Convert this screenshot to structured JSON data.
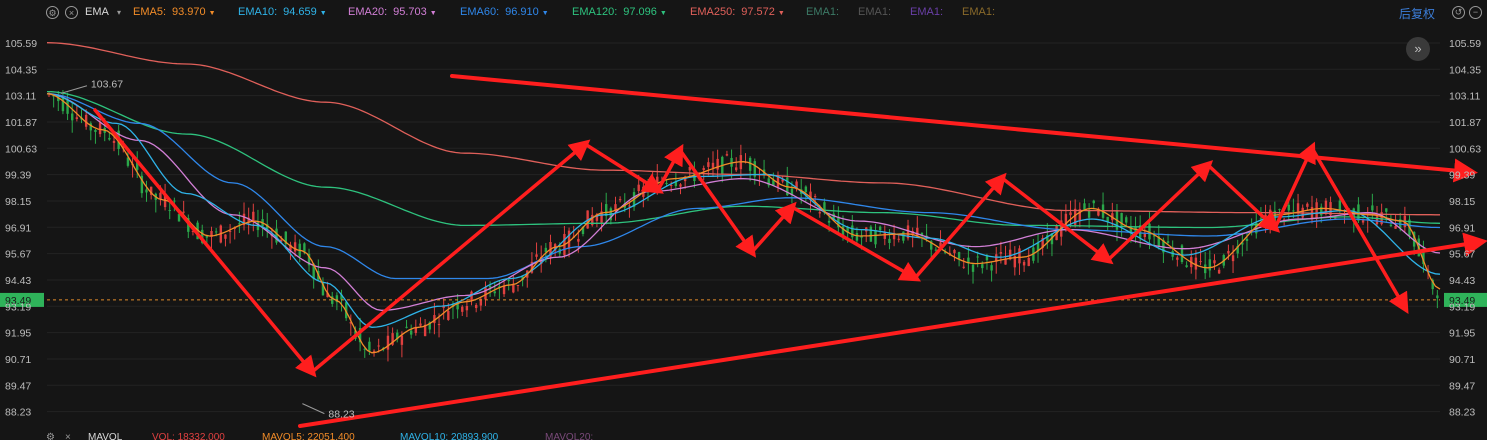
{
  "toolbar": {
    "indicator_name": "EMA",
    "restore_label": "后复权",
    "indicators": [
      {
        "name": "EMA5:",
        "value": "93.970",
        "color": "#f28c28",
        "arrow": true
      },
      {
        "name": "EMA10:",
        "value": "94.659",
        "color": "#2fb3e8",
        "arrow": true
      },
      {
        "name": "EMA20:",
        "value": "95.703",
        "color": "#d27fd6",
        "arrow": true
      },
      {
        "name": "EMA60:",
        "value": "96.910",
        "color": "#2f87ea",
        "arrow": true
      },
      {
        "name": "EMA120:",
        "value": "97.096",
        "color": "#2ec27e",
        "arrow": true
      },
      {
        "name": "EMA250:",
        "value": "97.572",
        "color": "#e0605a",
        "arrow": true
      },
      {
        "name": "EMA1:",
        "value": "",
        "color": "#3c7a66",
        "arrow": false
      },
      {
        "name": "EMA1:",
        "value": "",
        "color": "#555555",
        "arrow": false
      },
      {
        "name": "EMA1:",
        "value": "",
        "color": "#6a3fa8",
        "arrow": false
      },
      {
        "name": "EMA1:",
        "value": "",
        "color": "#8a6a2a",
        "arrow": false
      }
    ]
  },
  "volume_bar": {
    "label": "MAVOL",
    "items": [
      {
        "name": "VOL:",
        "value": "18332.000",
        "color": "#e04040"
      },
      {
        "name": "MAVOL5:",
        "value": "22051.400",
        "color": "#f28c28"
      },
      {
        "name": "MAVOL10:",
        "value": "20893.900",
        "color": "#2fb3e8"
      },
      {
        "name": "MAVOL20:",
        "value": "",
        "color": "#7a4a7a"
      }
    ]
  },
  "chart_data": {
    "type": "line",
    "y_ticks": [
      "105.59",
      "104.35",
      "103.11",
      "101.87",
      "100.63",
      "99.39",
      "98.15",
      "96.91",
      "95.67",
      "94.43",
      "93.19",
      "91.95",
      "90.71",
      "89.47",
      "88.23"
    ],
    "ylim": [
      87.6,
      106.2
    ],
    "current_price": "93.49",
    "high_label": "103.67",
    "low_label": "88.23",
    "n_bars": 300,
    "series": [
      {
        "name": "EMA5",
        "color": "#f28c28",
        "anchors": [
          [
            0,
            103.2
          ],
          [
            12,
            101.5
          ],
          [
            25,
            98.2
          ],
          [
            35,
            96.5
          ],
          [
            45,
            97.2
          ],
          [
            55,
            95.8
          ],
          [
            62,
            93.5
          ],
          [
            70,
            91.0
          ],
          [
            80,
            92.2
          ],
          [
            90,
            93.4
          ],
          [
            100,
            94.2
          ],
          [
            110,
            96.0
          ],
          [
            120,
            97.6
          ],
          [
            135,
            99.2
          ],
          [
            150,
            100.0
          ],
          [
            160,
            98.8
          ],
          [
            175,
            96.5
          ],
          [
            185,
            96.6
          ],
          [
            200,
            95.2
          ],
          [
            210,
            95.5
          ],
          [
            225,
            97.8
          ],
          [
            235,
            96.8
          ],
          [
            250,
            95.0
          ],
          [
            265,
            97.5
          ],
          [
            275,
            97.8
          ],
          [
            285,
            97.5
          ],
          [
            292,
            97.2
          ],
          [
            300,
            94.0
          ]
        ]
      },
      {
        "name": "EMA10",
        "color": "#2fb3e8",
        "anchors": [
          [
            0,
            103.2
          ],
          [
            15,
            101.8
          ],
          [
            30,
            98.5
          ],
          [
            45,
            97.0
          ],
          [
            60,
            94.3
          ],
          [
            70,
            92.2
          ],
          [
            85,
            93.2
          ],
          [
            100,
            94.5
          ],
          [
            120,
            97.5
          ],
          [
            140,
            99.3
          ],
          [
            155,
            99.4
          ],
          [
            175,
            96.8
          ],
          [
            190,
            96.4
          ],
          [
            205,
            95.5
          ],
          [
            225,
            97.3
          ],
          [
            245,
            95.6
          ],
          [
            265,
            97.4
          ],
          [
            280,
            97.7
          ],
          [
            300,
            94.7
          ]
        ]
      },
      {
        "name": "EMA20",
        "color": "#d27fd6",
        "anchors": [
          [
            0,
            103.2
          ],
          [
            20,
            101.0
          ],
          [
            40,
            97.5
          ],
          [
            60,
            95.0
          ],
          [
            72,
            93.0
          ],
          [
            90,
            93.7
          ],
          [
            110,
            95.5
          ],
          [
            130,
            98.6
          ],
          [
            150,
            99.2
          ],
          [
            175,
            97.2
          ],
          [
            200,
            96.0
          ],
          [
            220,
            96.8
          ],
          [
            245,
            95.9
          ],
          [
            270,
            97.3
          ],
          [
            285,
            97.6
          ],
          [
            300,
            95.7
          ]
        ]
      },
      {
        "name": "EMA60",
        "color": "#2f87ea",
        "anchors": [
          [
            0,
            103.2
          ],
          [
            20,
            101.8
          ],
          [
            40,
            99.0
          ],
          [
            60,
            96.0
          ],
          [
            75,
            94.5
          ],
          [
            95,
            94.5
          ],
          [
            115,
            96.0
          ],
          [
            140,
            97.8
          ],
          [
            160,
            98.3
          ],
          [
            190,
            97.6
          ],
          [
            220,
            96.8
          ],
          [
            250,
            96.5
          ],
          [
            280,
            97.3
          ],
          [
            300,
            96.9
          ]
        ]
      },
      {
        "name": "EMA120",
        "color": "#2ec27e",
        "anchors": [
          [
            0,
            103.3
          ],
          [
            30,
            101.3
          ],
          [
            60,
            98.8
          ],
          [
            90,
            97.0
          ],
          [
            120,
            97.1
          ],
          [
            150,
            97.9
          ],
          [
            180,
            97.6
          ],
          [
            210,
            97.0
          ],
          [
            250,
            96.9
          ],
          [
            280,
            97.4
          ],
          [
            300,
            97.1
          ]
        ]
      },
      {
        "name": "EMA250",
        "color": "#e0605a",
        "anchors": [
          [
            0,
            105.6
          ],
          [
            30,
            104.6
          ],
          [
            60,
            102.8
          ],
          [
            90,
            100.4
          ],
          [
            120,
            99.6
          ],
          [
            150,
            99.4
          ],
          [
            180,
            99.0
          ],
          [
            220,
            97.7
          ],
          [
            260,
            97.6
          ],
          [
            300,
            97.5
          ]
        ]
      }
    ]
  }
}
